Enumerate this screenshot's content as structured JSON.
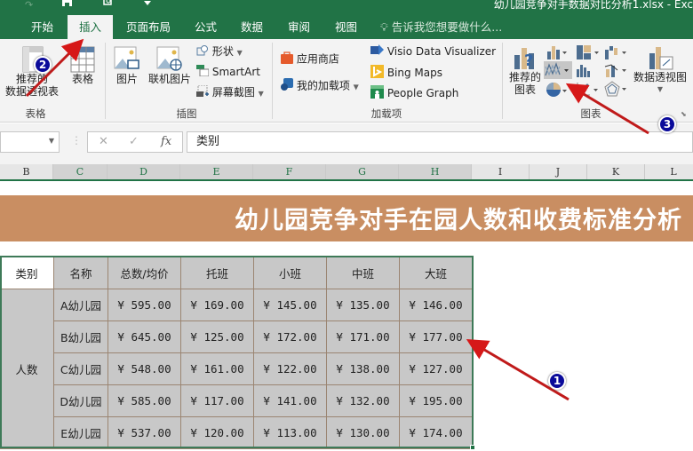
{
  "window": {
    "title": "幼儿园竞争对手数据对比分析1.xlsx - Exc"
  },
  "ribbon_tabs": [
    {
      "label": "开始",
      "active": false
    },
    {
      "label": "插入",
      "active": true
    },
    {
      "label": "页面布局",
      "active": false
    },
    {
      "label": "公式",
      "active": false
    },
    {
      "label": "数据",
      "active": false
    },
    {
      "label": "审阅",
      "active": false
    },
    {
      "label": "视图",
      "active": false
    }
  ],
  "tell_me": "告诉我您想要做什么...",
  "groups": {
    "tables": {
      "label": "表格",
      "recommended_pivot": "推荐的\n数据透视表",
      "recommended_pivot_l1": "推荐的",
      "recommended_pivot_l2": "数据透视表",
      "table": "表格"
    },
    "illustrations": {
      "label": "插图",
      "pictures": "图片",
      "online_pictures": "联机图片",
      "shapes": "形状",
      "smartart": "SmartArt",
      "screenshot": "屏幕截图"
    },
    "addins": {
      "label": "加载项",
      "store": "应用商店",
      "my_addins": "我的加载项",
      "visio": "Visio Data Visualizer",
      "bing": "Bing Maps",
      "people": "People Graph"
    },
    "charts": {
      "label": "图表",
      "recommended_l1": "推荐的",
      "recommended_l2": "图表",
      "pivot_chart": "数据透视图"
    }
  },
  "formula_bar": {
    "name_box": "",
    "cancel": "✕",
    "enter": "✓",
    "fx": "fx",
    "content": "类别"
  },
  "columns": [
    "B",
    "C",
    "D",
    "E",
    "F",
    "G",
    "H",
    "I",
    "J",
    "K",
    "L"
  ],
  "sheet": {
    "banner_title": "幼儿园竞争对手在园人数和收费标准分析",
    "headers": [
      "类别",
      "名称",
      "总数/均价",
      "托班",
      "小班",
      "中班",
      "大班"
    ],
    "category": "人数",
    "rows": [
      {
        "name": "A幼儿园",
        "total": "¥ 595.00",
        "tuoban": "¥ 169.00",
        "xiaoban": "¥ 145.00",
        "zhongban": "¥ 135.00",
        "daban": "¥ 146.00"
      },
      {
        "name": "B幼儿园",
        "total": "¥ 645.00",
        "tuoban": "¥ 125.00",
        "xiaoban": "¥ 172.00",
        "zhongban": "¥ 171.00",
        "daban": "¥ 177.00"
      },
      {
        "name": "C幼儿园",
        "total": "¥ 548.00",
        "tuoban": "¥ 161.00",
        "xiaoban": "¥ 122.00",
        "zhongban": "¥ 138.00",
        "daban": "¥ 127.00"
      },
      {
        "name": "D幼儿园",
        "total": "¥ 585.00",
        "tuoban": "¥ 117.00",
        "xiaoban": "¥ 141.00",
        "zhongban": "¥ 132.00",
        "daban": "¥ 195.00"
      },
      {
        "name": "E幼儿园",
        "total": "¥ 537.00",
        "tuoban": "¥ 120.00",
        "xiaoban": "¥ 113.00",
        "zhongban": "¥ 130.00",
        "daban": "¥ 174.00"
      }
    ]
  },
  "annotations": [
    "1",
    "2",
    "3"
  ],
  "colors": {
    "excel_green": "#217346",
    "banner": "#c98e62",
    "cell_gray": "#c8c8c8",
    "arrow_red": "#cc1a1a",
    "badge_blue": "#0a0a9a"
  }
}
